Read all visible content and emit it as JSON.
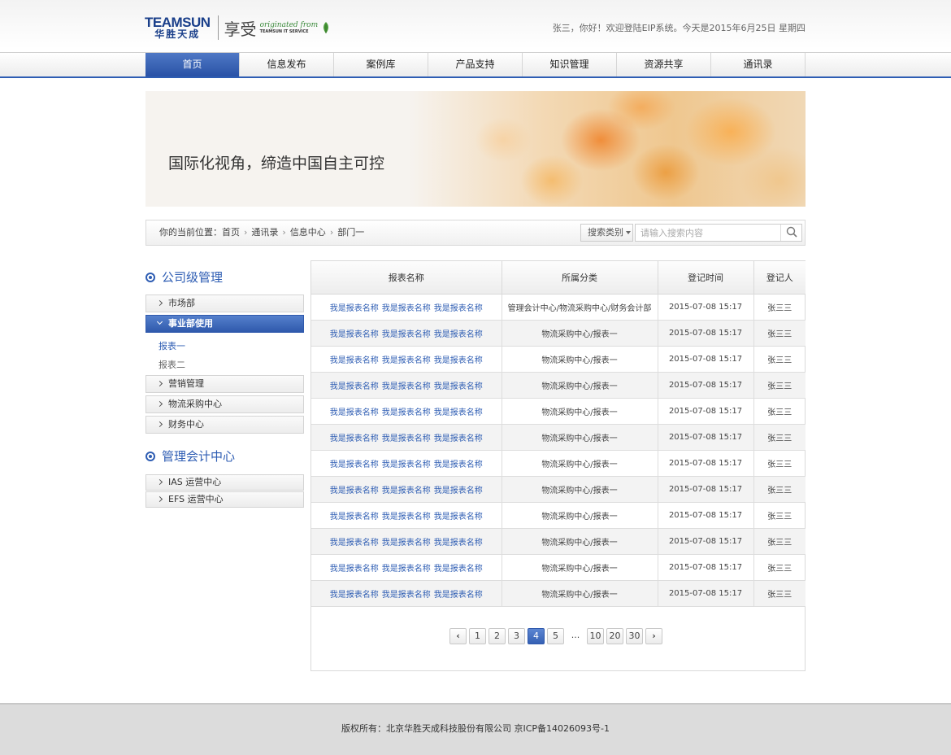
{
  "header": {
    "logo_en": "TEAMSUN",
    "logo_cn": "华胜天成",
    "slogan": "享受",
    "slogan_script": "originated from",
    "slogan_small": "TEAMSUN IT SERVICE",
    "welcome": "张三，你好！欢迎登陆EIP系统。今天是2015年6月25日 星期四"
  },
  "nav": {
    "items": [
      "首页",
      "信息发布",
      "案例库",
      "产品支持",
      "知识管理",
      "资源共享",
      "通讯录"
    ],
    "active_index": 0
  },
  "banner": {
    "text": "国际化视角，缔造中国自主可控"
  },
  "breadcrumb": {
    "prefix": "你的当前位置：",
    "items": [
      "首页",
      "通讯录",
      "信息中心",
      "部门一"
    ]
  },
  "search": {
    "type_label": "搜索类别",
    "placeholder": "请输入搜索内容",
    "value": ""
  },
  "sidebar": {
    "section1_title": "公司级管理",
    "section1_items": [
      "市场部",
      "事业部使用",
      "营销管理",
      "物流采购中心",
      "财务中心"
    ],
    "active_item": "事业部使用",
    "sub_items": [
      "报表一",
      "报表二"
    ],
    "section2_title": "管理会计中心",
    "section2_items": [
      "IAS 运营中心",
      "EFS 运营中心"
    ]
  },
  "table": {
    "headers": [
      "报表名称",
      "所属分类",
      "登记时间",
      "登记人"
    ],
    "link_text": "我是报表名称",
    "rows": [
      {
        "category": "管理会计中心/物流采购中心/财务会计部",
        "time": "2015-07-08 15:17",
        "person": "张三三"
      },
      {
        "category": "物流采购中心/报表一",
        "time": "2015-07-08 15:17",
        "person": "张三三"
      },
      {
        "category": "物流采购中心/报表一",
        "time": "2015-07-08 15:17",
        "person": "张三三"
      },
      {
        "category": "物流采购中心/报表一",
        "time": "2015-07-08 15:17",
        "person": "张三三"
      },
      {
        "category": "物流采购中心/报表一",
        "time": "2015-07-08 15:17",
        "person": "张三三"
      },
      {
        "category": "物流采购中心/报表一",
        "time": "2015-07-08 15:17",
        "person": "张三三"
      },
      {
        "category": "物流采购中心/报表一",
        "time": "2015-07-08 15:17",
        "person": "张三三"
      },
      {
        "category": "物流采购中心/报表一",
        "time": "2015-07-08 15:17",
        "person": "张三三"
      },
      {
        "category": "物流采购中心/报表一",
        "time": "2015-07-08 15:17",
        "person": "张三三"
      },
      {
        "category": "物流采购中心/报表一",
        "time": "2015-07-08 15:17",
        "person": "张三三"
      },
      {
        "category": "物流采购中心/报表一",
        "time": "2015-07-08 15:17",
        "person": "张三三"
      },
      {
        "category": "物流采购中心/报表一",
        "time": "2015-07-08 15:17",
        "person": "张三三"
      }
    ]
  },
  "pagination": {
    "prev": "‹",
    "pages": [
      "1",
      "2",
      "3",
      "4",
      "5",
      "...",
      "10",
      "20",
      "30"
    ],
    "current": "4",
    "next": "›"
  },
  "footer": {
    "text": "版权所有：北京华胜天成科技股份有限公司   京ICP备14026093号-1"
  },
  "colors": {
    "accent": "#2e5db3",
    "link": "#2e5db3",
    "footer_bg": "#dcdcdc"
  }
}
